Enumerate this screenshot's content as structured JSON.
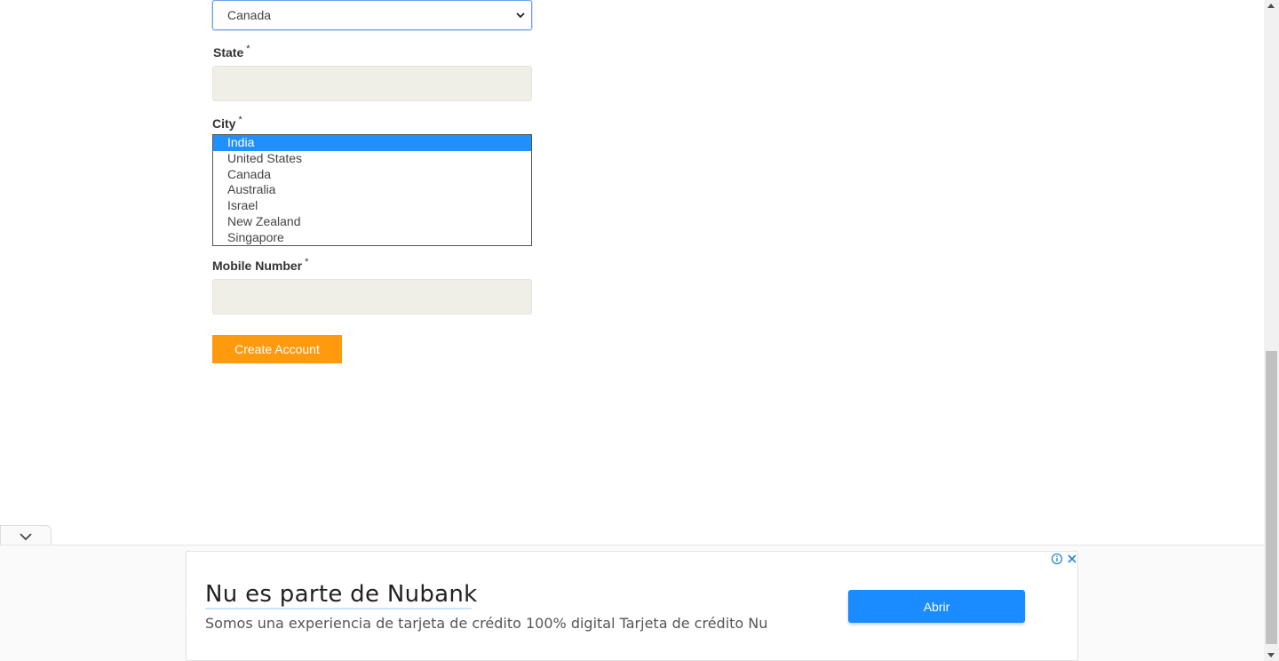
{
  "form": {
    "country_select_value": "Canada",
    "state_label": "State",
    "city_label": "City",
    "mobile_label": "Mobile Number",
    "required_mark": "*",
    "city_options": [
      "India",
      "United States",
      "Canada",
      "Australia",
      "Israel",
      "New Zealand",
      "Singapore"
    ],
    "city_selected_option": "India",
    "create_button_label": "Create Account"
  },
  "ad": {
    "title": "Nu es parte de Nubank",
    "description": "Somos una experiencia de tarjeta de crédito 100% digital Tarjeta de crédito Nu",
    "button_label": "Abrir",
    "accent_color": "#1a8cff"
  },
  "icons": {
    "select_chevron": "chevron-down-icon",
    "ad_collapse": "chevron-down-icon",
    "ad_info": "info-icon",
    "ad_close": "close-icon"
  },
  "colors": {
    "primary_button": "#ff9a0e",
    "selected_option": "#1e90ff",
    "input_background": "#efefe8"
  }
}
